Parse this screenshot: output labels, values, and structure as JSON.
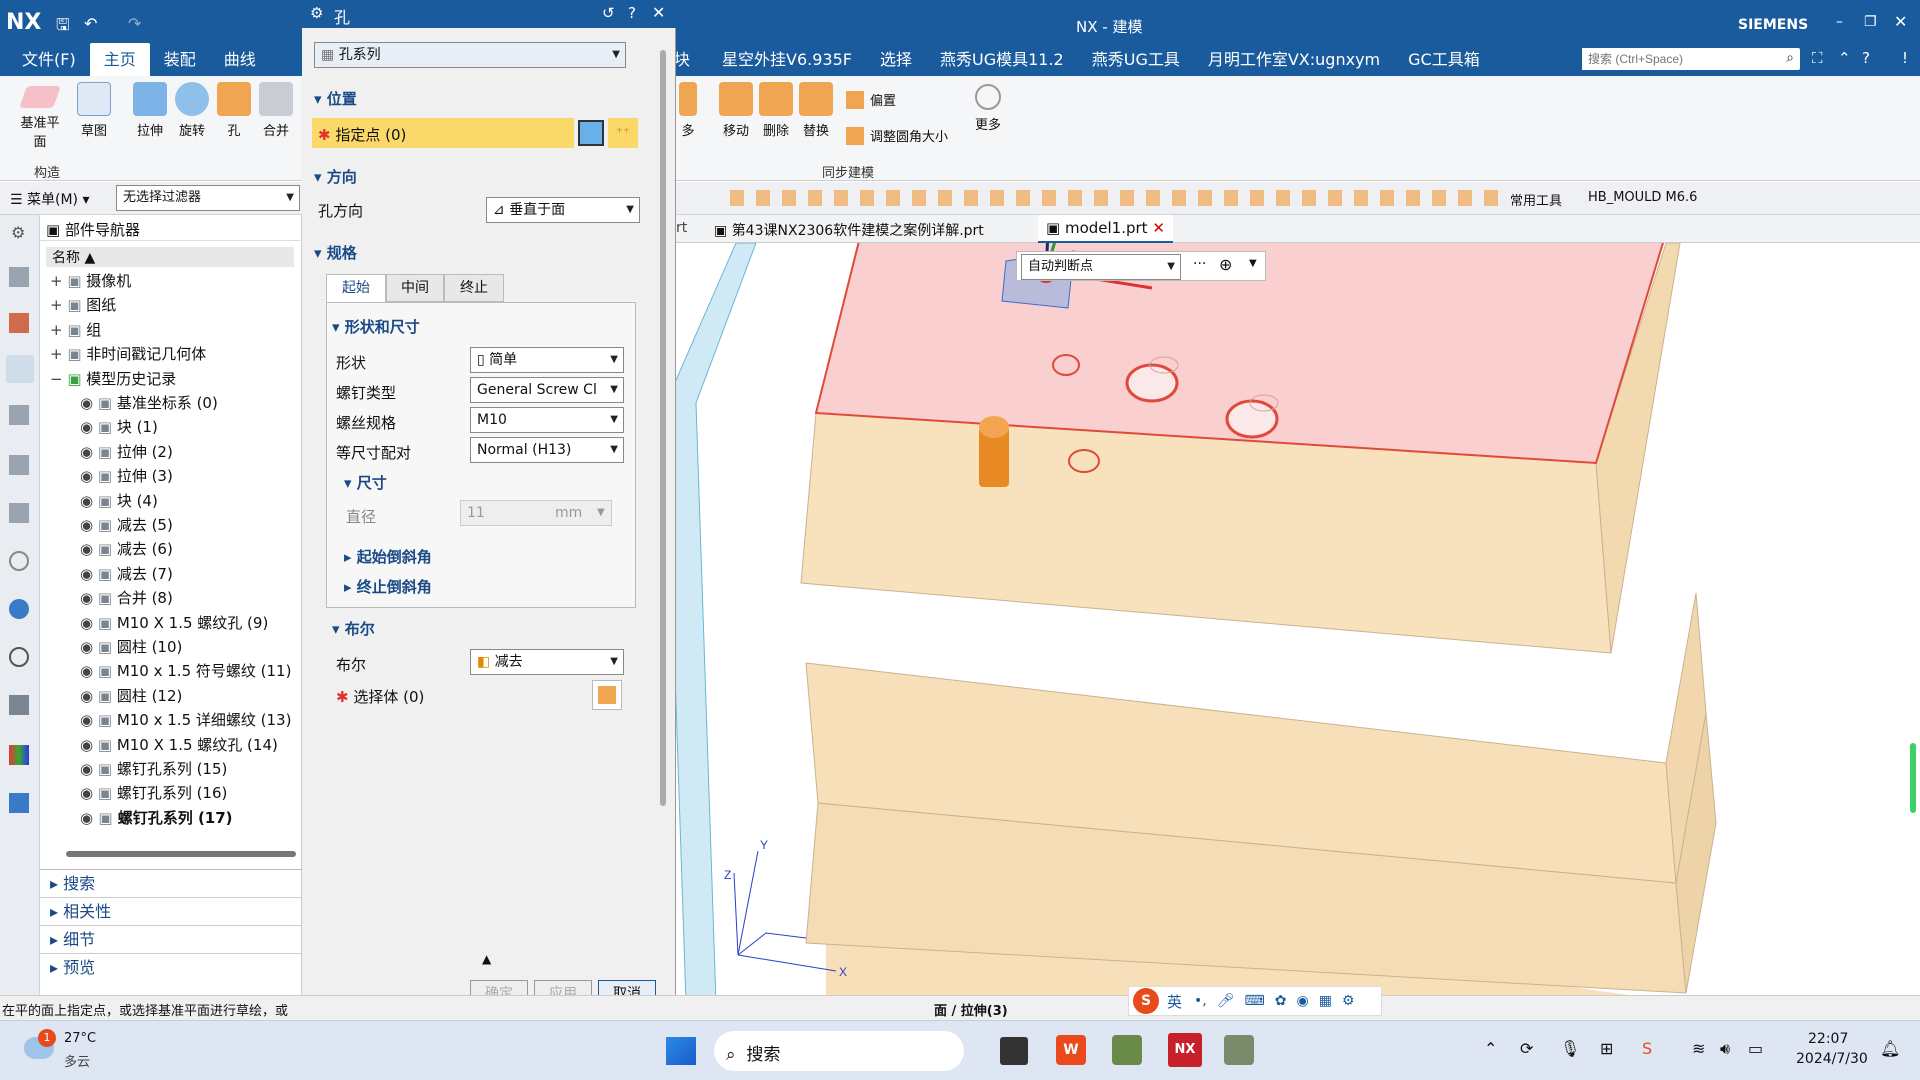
{
  "app": {
    "logo": "NX",
    "title": "NX - 建模",
    "brand": "SIEMENS",
    "search_placeholder": "搜索 (Ctrl+Space)"
  },
  "menu": {
    "left": [
      "文件(F)",
      "主页",
      "装配",
      "曲线"
    ],
    "right": [
      "星空外挂V6.935F",
      "选择",
      "燕秀UG模具11.2",
      "燕秀UG工具",
      "月明工作室VX:ugnxym",
      "GC工具箱"
    ],
    "partial": "块"
  },
  "ribbon": {
    "construct": [
      "基准平面",
      "草图",
      "拉伸",
      "旋转",
      "孔",
      "合并"
    ],
    "construct_group": "构造",
    "sync": [
      "多",
      "移动",
      "删除",
      "替换"
    ],
    "sync_small": [
      "偏置",
      "调整圆角大小"
    ],
    "sync_more": "更多",
    "sync_group": "同步建模"
  },
  "toolrow": {
    "menu": "菜单(M)",
    "filter": "无选择过滤器",
    "common_tools": "常用工具",
    "mould": "HB_MOULD M6.6"
  },
  "tabs": [
    "第43课NX2306软件建模之案例详解.prt",
    "model1.prt"
  ],
  "tabs_partial": "rt",
  "navigator": {
    "title": "部件导航器",
    "column": "名称",
    "items": [
      {
        "label": "摄像机"
      },
      {
        "label": "图纸"
      },
      {
        "label": "组"
      },
      {
        "label": "非时间戳记几何体"
      },
      {
        "label": "模型历史记录"
      },
      {
        "label": "基准坐标系 (0)"
      },
      {
        "label": "块 (1)"
      },
      {
        "label": "拉伸 (2)"
      },
      {
        "label": "拉伸 (3)"
      },
      {
        "label": "块 (4)"
      },
      {
        "label": "减去 (5)"
      },
      {
        "label": "减去 (6)"
      },
      {
        "label": "减去 (7)"
      },
      {
        "label": "合并 (8)"
      },
      {
        "label": "M10 X 1.5 螺纹孔 (9)"
      },
      {
        "label": "圆柱 (10)"
      },
      {
        "label": "M10 x 1.5 符号螺纹 (11)"
      },
      {
        "label": "圆柱 (12)"
      },
      {
        "label": "M10 x 1.5 详细螺纹 (13)"
      },
      {
        "label": "M10 X 1.5 螺纹孔 (14)"
      },
      {
        "label": "螺钉孔系列 (15)"
      },
      {
        "label": "螺钉孔系列 (16)"
      },
      {
        "label": "螺钉孔系列 (17)"
      }
    ],
    "bottom": [
      "搜索",
      "相关性",
      "细节",
      "预览"
    ]
  },
  "dialog": {
    "title": "孔",
    "type": "孔系列",
    "position": {
      "header": "位置",
      "point": "指定点 (0)"
    },
    "direction": {
      "header": "方向",
      "label": "孔方向",
      "value": "垂直于面"
    },
    "spec": {
      "header": "规格",
      "tabs": [
        "起始",
        "中间",
        "终止"
      ],
      "shape_header": "形状和尺寸",
      "shape_label": "形状",
      "shape_value": "简单",
      "screw_type_label": "螺钉类型",
      "screw_type_value": "General Screw Cl",
      "screw_size_label": "螺丝规格",
      "screw_size_value": "M10",
      "fit_label": "等尺寸配对",
      "fit_value": "Normal (H13)",
      "dim_header": "尺寸",
      "diameter_label": "直径",
      "diameter_value": "11",
      "diameter_unit": "mm",
      "start_chamfer": "起始倒斜角",
      "end_chamfer": "终止倒斜角"
    },
    "boolean": {
      "header": "布尔",
      "label": "布尔",
      "value": "减去",
      "select": "选择体 (0)"
    },
    "buttons": {
      "ok": "确定",
      "apply": "应用",
      "cancel": "取消"
    }
  },
  "viewport": {
    "snap": "自动判断点",
    "dots": "···",
    "axis_x": "X",
    "axis_y": "Y",
    "axis_z": "Z"
  },
  "status": {
    "hint": "在平的面上指定点，或选择基准平面进行草绘，或",
    "selection": "面 / 拉伸(3)",
    "ime": "英"
  },
  "taskbar": {
    "weather_temp": "27°C",
    "weather_desc": "多云",
    "badge": "1",
    "search": "搜索",
    "time": "22:07",
    "date": "2024/7/30"
  },
  "colors": {
    "accent": "#1a5b9e",
    "highlight": "#fbd86a",
    "face": "#f9cfcf",
    "body": "#f7dfb9"
  }
}
